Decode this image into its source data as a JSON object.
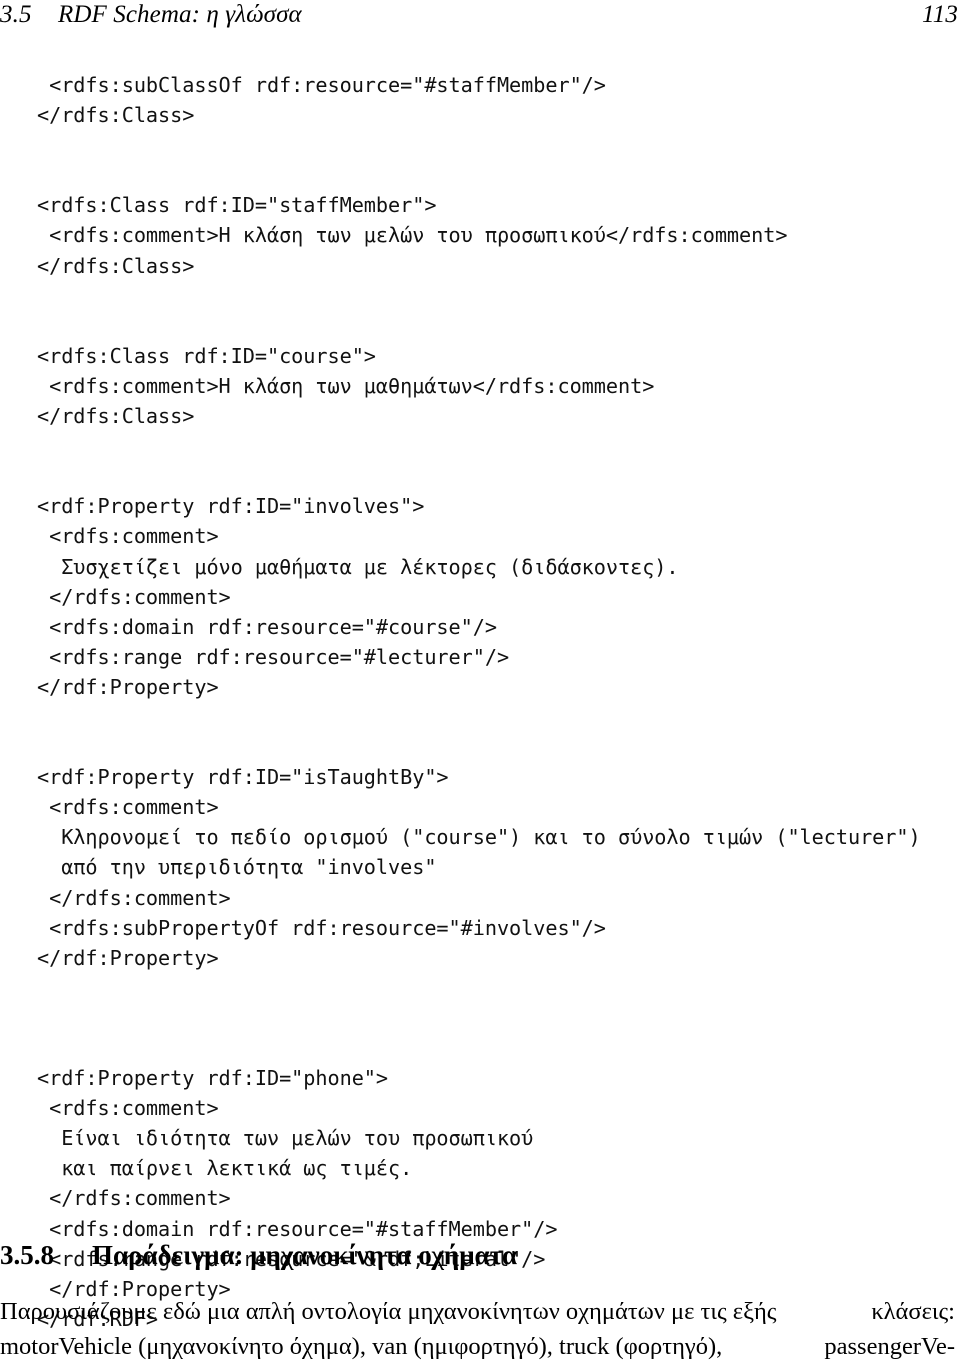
{
  "header": {
    "section_number": "3.5",
    "title": "RDF Schema: η γλώσσα",
    "page_number": "113"
  },
  "code_listing": {
    "language": "xml",
    "lines": [
      " <rdfs:subClassOf rdf:resource=\"#staffMember\"/>",
      "</rdfs:Class>",
      "",
      "",
      "<rdfs:Class rdf:ID=\"staffMember\">",
      " <rdfs:comment>Η κλάση των μελών του προσωπικού</rdfs:comment>",
      "</rdfs:Class>",
      "",
      "",
      "<rdfs:Class rdf:ID=\"course\">",
      " <rdfs:comment>Η κλάση των μαθημάτων</rdfs:comment>",
      "</rdfs:Class>",
      "",
      "",
      "<rdf:Property rdf:ID=\"involves\">",
      " <rdfs:comment>",
      "  Συσχετίζει μόνο μαθήματα με λέκτορες (διδάσκοντες).",
      " </rdfs:comment>",
      " <rdfs:domain rdf:resource=\"#course\"/>",
      " <rdfs:range rdf:resource=\"#lecturer\"/>",
      "</rdf:Property>",
      "",
      "",
      "<rdf:Property rdf:ID=\"isTaughtBy\">",
      " <rdfs:comment>",
      "  Κληρονομεί το πεδίο ορισμού (\"course\") και το σύνολο τιμών (\"lecturer\")",
      "  από την υπεριδιότητα \"involves\"",
      " </rdfs:comment>",
      " <rdfs:subPropertyOf rdf:resource=\"#involves\"/>",
      "</rdf:Property>",
      "",
      "",
      "",
      "<rdf:Property rdf:ID=\"phone\">",
      " <rdfs:comment>",
      "  Είναι ιδιότητα των μελών του προσωπικού",
      "  και παίρνει λεκτικά ως τιμές.",
      " </rdfs:comment>",
      " <rdfs:domain rdf:resource=\"#staffMember\"/>",
      " <rdfs:range rdf:resource=\"&rdf;Literal\"/>",
      " </rdf:Property>",
      "</rdf:RDF>"
    ]
  },
  "section": {
    "number": "3.5.8",
    "title": "Παράδειγμα: μηχανοκίνητα οχήματα"
  },
  "paragraph": {
    "line1_left": "Παρουσιάζουμε εδώ μια απλή οντολογία μηχανοκίνητων οχημάτων με τις εξής",
    "line1_right": "κλάσεις:",
    "line2_left": "motorVehicle (μηχανοκίνητο όχημα), van (ημιφορτηγό), truck (φορτηγό),",
    "line2_right": "passengerVe-"
  }
}
